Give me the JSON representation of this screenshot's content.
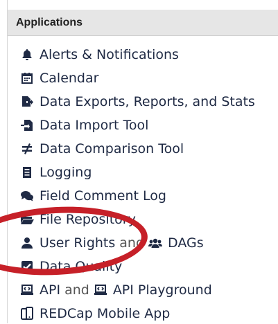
{
  "panel": {
    "header_title": "Applications"
  },
  "items": [
    {
      "icon": "bell-icon",
      "label": "Alerts & Notifications"
    },
    {
      "icon": "calendar-icon",
      "label": "Calendar"
    },
    {
      "icon": "file-export-icon",
      "label": "Data Exports, Reports, and Stats"
    },
    {
      "icon": "file-import-icon",
      "label": "Data Import Tool"
    },
    {
      "icon": "not-equal-icon",
      "label": "Data Comparison Tool"
    },
    {
      "icon": "list-icon",
      "label": "Logging"
    },
    {
      "icon": "comments-icon",
      "label": "Field Comment Log"
    },
    {
      "icon": "folder-open-icon",
      "label": "File Repository"
    },
    {
      "icon": "user-icon",
      "label": "User Rights",
      "joiner": "and",
      "second_icon": "users-icon",
      "second_label": "DAGs"
    },
    {
      "icon": "check-square-icon",
      "label": "Data Quality"
    },
    {
      "icon": "laptop-code-icon",
      "label": "API",
      "joiner": "and",
      "second_icon": "laptop-code-icon",
      "second_label": "API Playground"
    },
    {
      "icon": "mobile-icon",
      "label": "REDCap Mobile App"
    }
  ],
  "annotation": {
    "color": "#c62028"
  }
}
